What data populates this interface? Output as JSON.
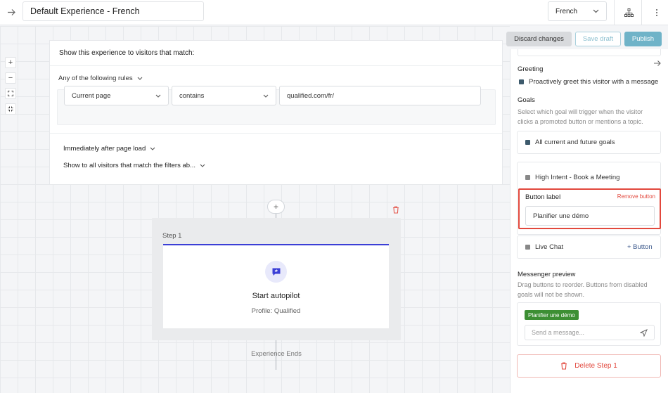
{
  "header": {
    "title": "Default Experience - French",
    "language": "French"
  },
  "actions": {
    "discard": "Discard changes",
    "save_draft": "Save draft",
    "publish": "Publish"
  },
  "rules": {
    "heading": "Show this experience to visitors that match:",
    "logic": "Any of the following rules",
    "rule": {
      "field": "Current page",
      "operator": "contains",
      "value": "qualified.com/fr/"
    },
    "timing": "Immediately after page load",
    "audience": "Show to all visitors that match the filters ab..."
  },
  "flow": {
    "step_label": "Step 1",
    "step_title": "Start autopilot",
    "step_profile": "Profile: Qualified",
    "end_label": "Experience Ends"
  },
  "panel": {
    "greeting_heading": "Greeting",
    "greeting_option": "Proactively greet this visitor with a message",
    "goals_heading": "Goals",
    "goals_help": [
      "Select which goal will trigger when the visitor",
      "clicks a promoted button or mentions a topic."
    ],
    "goal_all": "All current and future goals",
    "goal_high_intent": "High Intent - Book a Meeting",
    "button_label_heading": "Button label",
    "remove_button": "Remove button",
    "button_label_value": "Planifier une démo",
    "goal_live_chat": "Live Chat",
    "add_button": "+ Button",
    "preview_heading": "Messenger preview",
    "preview_help": [
      "Drag buttons to reorder. Buttons from disabled",
      "goals will not be shown."
    ],
    "preview_chip": "Planifier une démo",
    "message_placeholder": "Send a message...",
    "delete_step": "Delete Step 1"
  },
  "colors": {
    "accent_blue": "#3b3fd6",
    "publish_teal": "#6fb3c8",
    "danger_red": "#e2483d",
    "chip_green": "#3d8f34"
  }
}
